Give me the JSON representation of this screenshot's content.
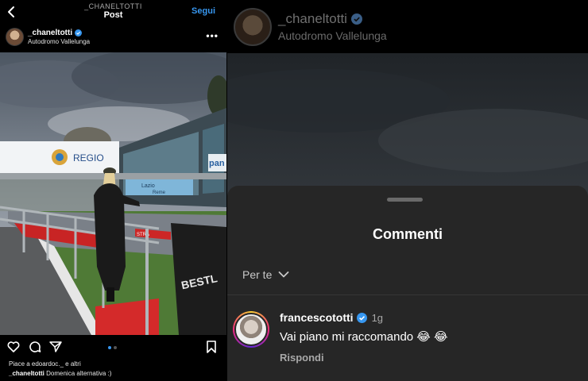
{
  "left_post": {
    "topbar": {
      "username": "_CHANELTOTTI",
      "title": "Post",
      "follow_label": "Segui"
    },
    "author": {
      "username": "_chaneltotti",
      "location": "Autodromo Vallelunga",
      "more_label": "•••"
    },
    "photo": {
      "sign_regione": "REGIO",
      "sign_lazio": "Lazio",
      "sign_roma": "Reme",
      "sign_partial": "pan",
      "wall_text": "BESTL",
      "barrier_text": "STRA"
    },
    "likes_text": "Piace a edoardoc._ e altri",
    "caption": {
      "username": "_chaneltotti",
      "text": "Domenica alternativa :)"
    },
    "carousel": {
      "active_index": 0,
      "count": 2
    }
  },
  "right_panel": {
    "header": {
      "username": "_chaneltotti",
      "location": "Autodromo Vallelunga"
    },
    "sheet": {
      "title": "Commenti",
      "filter_label": "Per te"
    },
    "comment": {
      "username": "francescototti",
      "time": "1g",
      "text": "Vai piano mi raccomando 😂 😂",
      "reply_label": "Rispondi"
    }
  },
  "colors": {
    "accent_blue": "#3797f0",
    "sheet_bg": "#262626",
    "background": "#000000"
  }
}
